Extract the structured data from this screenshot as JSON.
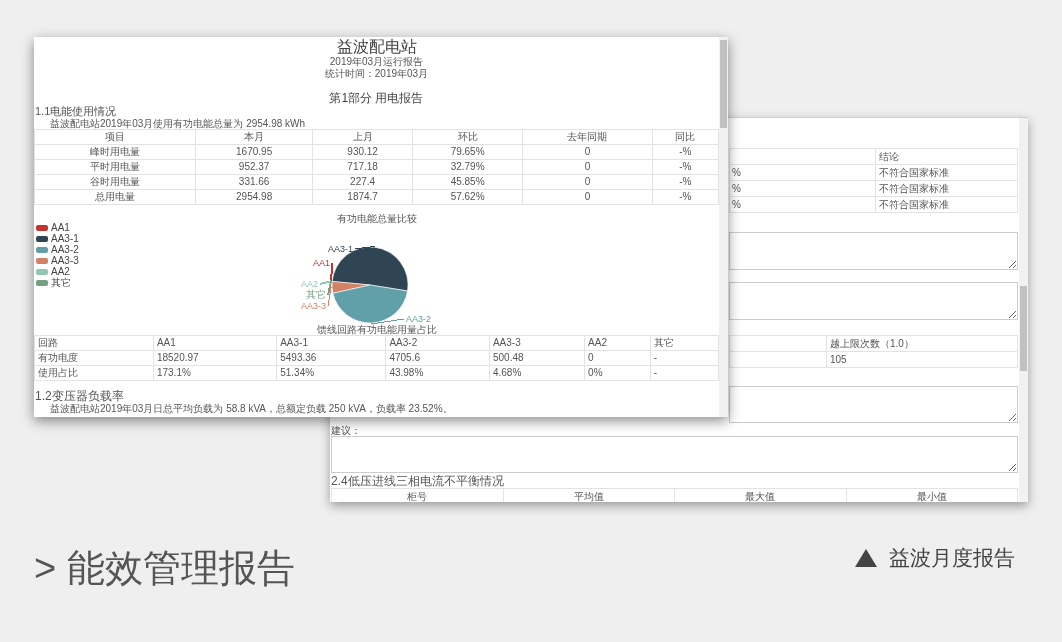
{
  "report_window": {
    "title": "益波配电站",
    "subtitle": "2019年03月运行报告",
    "period": "统计时间：2019年03月",
    "part_heading": "第1部分 用电报告",
    "energy_section": {
      "heading": "1.1电能使用情况",
      "summary": "益波配电站2019年03月使用有功电能总量为 2954.98 kWh",
      "columns": [
        "项目",
        "本月",
        "上月",
        "环比",
        "去年同期",
        "同比"
      ],
      "rows": [
        [
          "峰时用电量",
          "1670.95",
          "930.12",
          "79.65%",
          "0",
          "-%"
        ],
        [
          "平时用电量",
          "952.37",
          "717.18",
          "32.79%",
          "0",
          "-%"
        ],
        [
          "谷时用电量",
          "331.66",
          "227.4",
          "45.85%",
          "0",
          "-%"
        ],
        [
          "总用电量",
          "2954.98",
          "1874.7",
          "57.62%",
          "0",
          "-%"
        ]
      ]
    },
    "pie": {
      "title": "有功电能总量比较",
      "caption": "馈线回路有功电能用量占比",
      "legend": [
        {
          "label": "AA1",
          "color": "#c23531"
        },
        {
          "label": "AA3-1",
          "color": "#2f4554"
        },
        {
          "label": "AA3-2",
          "color": "#61a0a8"
        },
        {
          "label": "AA3-3",
          "color": "#d48265"
        },
        {
          "label": "AA2",
          "color": "#91c7ae"
        },
        {
          "label": "其它",
          "color": "#749f83"
        }
      ],
      "slices": [
        {
          "label": "AA3-1",
          "color": "#2f4554"
        },
        {
          "label": "AA1",
          "color": "#c23531"
        },
        {
          "label": "AA2",
          "color": "#91c7ae"
        },
        {
          "label": "其它",
          "color": "#749f83"
        },
        {
          "label": "AA3-3",
          "color": "#d48265"
        },
        {
          "label": "AA3-2",
          "color": "#61a0a8"
        }
      ]
    },
    "circuit_table": {
      "rows": [
        [
          "回路",
          "AA1",
          "AA3-1",
          "AA3-2",
          "AA3-3",
          "AA2",
          "其它"
        ],
        [
          "有功电度",
          "18520.97",
          "5493.36",
          "4705.6",
          "500.48",
          "0",
          "-"
        ],
        [
          "使用占比",
          "173.1%",
          "51.34%",
          "43.98%",
          "4.68%",
          "0%",
          "-"
        ]
      ]
    },
    "load_section": {
      "heading": "1.2变压器负载率",
      "summary": "益波配电站2019年03月日总平均负载为 58.8 kVA，总额定负载 250 kVA，负载率 23.52%。"
    }
  },
  "back_window": {
    "compliance_table": {
      "header": "结论",
      "rows": [
        {
          "value_tail": "%",
          "conclusion": "不符合国家标准"
        },
        {
          "value_tail": "%",
          "conclusion": "不符合国家标准"
        },
        {
          "value_tail": "%",
          "conclusion": "不符合国家标准"
        }
      ]
    },
    "limit_table": {
      "header": "越上限次数（1.0）",
      "value": "105"
    },
    "advice_label": "建议：",
    "imbalance_section": {
      "heading": "2.4低压进线三相电流不平衡情况",
      "columns": [
        "柜号",
        "平均值",
        "最大值",
        "最小值"
      ]
    }
  },
  "captions": {
    "main": "> 能效管理报告",
    "secondary": "益波月度报告"
  }
}
